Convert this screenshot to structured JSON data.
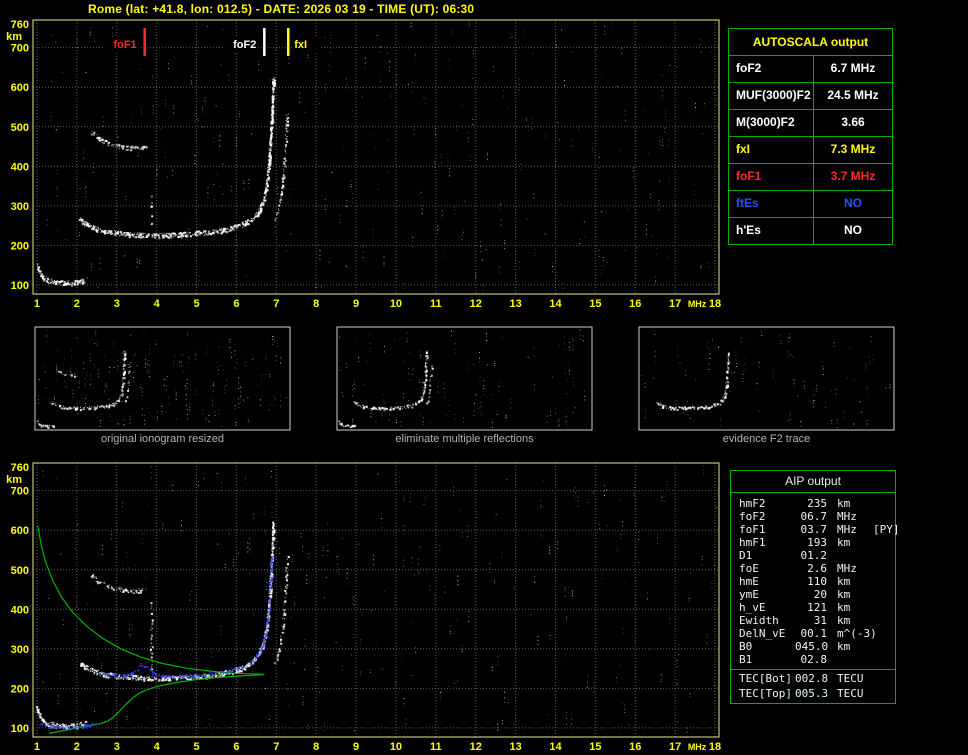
{
  "header": {
    "title": "Rome (lat: +41.8, lon: 012.5) - DATE: 2026 03 19 - TIME (UT): 06:30"
  },
  "colors": {
    "background": "#000000",
    "accent_yellow": "#ffff00",
    "plot_border": "#e6e68e",
    "grid": "#6f6f6f",
    "table_border": "#00b000",
    "trace_white": "#ffffff",
    "trace_blue": "#3040ff",
    "profile_green": "#00b400",
    "caption_gray": "#b4b4b4",
    "thumb_border": "#cfcfcf",
    "red": "#ff2a2a",
    "blue_text": "#2255ff",
    "noise_palette": [
      "#bdbdbd",
      "#8f8f8f",
      "#efefef",
      "#5f5f5f"
    ]
  },
  "autoscala_table": {
    "title": "AUTOSCALA output",
    "rows": [
      {
        "label": "foF2",
        "value": "6.7 MHz",
        "color": "#ffffff"
      },
      {
        "label": "MUF(3000)F2",
        "value": "24.5 MHz",
        "color": "#ffffff"
      },
      {
        "label": "M(3000)F2",
        "value": "3.66",
        "color": "#ffffff"
      },
      {
        "label": "fxI",
        "value": "7.3 MHz",
        "color": "#ffff00"
      },
      {
        "label": "foF1",
        "value": "3.7 MHz",
        "color": "#ff2a2a"
      },
      {
        "label": "ftEs",
        "value": "NO",
        "color": "#2255ff"
      },
      {
        "label": "h'Es",
        "value": "NO",
        "color": "#ffffff"
      }
    ]
  },
  "thumbnails": [
    {
      "caption": "original ionogram resized",
      "trace_indices": [
        0,
        1,
        2,
        3
      ],
      "noise_events": 150
    },
    {
      "caption": "eliminate multiple reflections",
      "trace_indices": [
        0,
        1,
        3
      ],
      "noise_events": 110
    },
    {
      "caption": "evidence F2 trace",
      "trace_indices": [
        1
      ],
      "noise_events": 80
    }
  ],
  "aip_table": {
    "title": "AIP output",
    "rows": [
      {
        "label": "hmF2",
        "value": "235",
        "unit": "km",
        "note": "",
        "sep": false
      },
      {
        "label": "foF2",
        "value": "06.7",
        "unit": "MHz",
        "note": "",
        "sep": false
      },
      {
        "label": "foF1",
        "value": "03.7",
        "unit": "MHz",
        "note": "[PY]",
        "sep": false
      },
      {
        "label": "hmF1",
        "value": "193",
        "unit": "km",
        "note": "",
        "sep": false
      },
      {
        "label": "D1",
        "value": "01.2",
        "unit": "",
        "note": "",
        "sep": false
      },
      {
        "label": "foE",
        "value": "2.6",
        "unit": "MHz",
        "note": "",
        "sep": false
      },
      {
        "label": "hmE",
        "value": "110",
        "unit": "km",
        "note": "",
        "sep": false
      },
      {
        "label": "ymE",
        "value": "20",
        "unit": "km",
        "note": "",
        "sep": false
      },
      {
        "label": "h_vE",
        "value": "121",
        "unit": "km",
        "note": "",
        "sep": false
      },
      {
        "label": "Ewidth",
        "value": "31",
        "unit": "km",
        "note": "",
        "sep": false
      },
      {
        "label": "DelN_vE",
        "value": "00.1",
        "unit": "m^(-3)",
        "note": "",
        "sep": false
      },
      {
        "label": "B0",
        "value": "045.0",
        "unit": "km",
        "note": "",
        "sep": false
      },
      {
        "label": "B1",
        "value": "02.8",
        "unit": "",
        "note": "",
        "sep": false
      },
      {
        "label": "TEC[Bot]",
        "value": "002.8",
        "unit": "TECU",
        "note": "",
        "sep": true
      },
      {
        "label": "TEC[Top]",
        "value": "005.3",
        "unit": "TECU",
        "note": "",
        "sep": false
      }
    ]
  },
  "chart_data": [
    {
      "id": "top_ionogram",
      "type": "scatter",
      "title": "scaled ionogram with critical frequency markers",
      "xlabel": "MHz",
      "ylabel": "km",
      "xlim": [
        0.9,
        18.1
      ],
      "ylim": [
        77,
        770
      ],
      "x_ticks": [
        1,
        2,
        3,
        4,
        5,
        6,
        7,
        8,
        9,
        10,
        11,
        12,
        13,
        14,
        15,
        16,
        17,
        18
      ],
      "y_ticks": [
        100,
        200,
        300,
        400,
        500,
        600,
        700,
        760
      ],
      "grid": true,
      "critical_frequencies": [
        {
          "label": "foF1",
          "mhz": 3.7,
          "color": "#ff2a2a",
          "side": "left"
        },
        {
          "label": "foF2",
          "mhz": 6.7,
          "color": "#ffffff",
          "side": "left"
        },
        {
          "label": "fxI",
          "mhz": 7.3,
          "color": "#ffff00",
          "side": "right"
        }
      ],
      "traces": [
        {
          "name": "E-layer echo",
          "color": "#ffffff",
          "thickness": 5,
          "density": 2.6,
          "points": [
            [
              1.0,
              150
            ],
            [
              1.05,
              133
            ],
            [
              1.15,
              119
            ],
            [
              1.3,
              111
            ],
            [
              1.5,
              107
            ],
            [
              1.75,
              105
            ],
            [
              2.0,
              107
            ],
            [
              2.2,
              112
            ]
          ]
        },
        {
          "name": "F1-F2 echo",
          "color": "#ffffff",
          "thickness": 5,
          "density": 2.6,
          "points": [
            [
              2.05,
              268
            ],
            [
              2.2,
              255
            ],
            [
              2.45,
              243
            ],
            [
              2.7,
              236
            ],
            [
              3.0,
              231
            ],
            [
              3.4,
              228
            ],
            [
              3.9,
              226
            ],
            [
              4.4,
              227
            ],
            [
              4.9,
              230
            ],
            [
              5.4,
              235
            ],
            [
              5.8,
              242
            ],
            [
              6.1,
              251
            ],
            [
              6.35,
              264
            ],
            [
              6.55,
              285
            ],
            [
              6.68,
              315
            ],
            [
              6.76,
              360
            ],
            [
              6.82,
              420
            ],
            [
              6.86,
              490
            ],
            [
              6.9,
              560
            ],
            [
              6.92,
              620
            ]
          ]
        },
        {
          "name": "second-hop echo",
          "color": "#ffffff",
          "thickness": 4,
          "density": 1.5,
          "points": [
            [
              2.35,
              487
            ],
            [
              2.55,
              470
            ],
            [
              2.8,
              458
            ],
            [
              3.1,
              450
            ],
            [
              3.45,
              447
            ],
            [
              3.75,
              450
            ]
          ]
        },
        {
          "name": "X-mode cusp",
          "color": "#ffffff",
          "thickness": 3,
          "density": 0.8,
          "points": [
            [
              6.95,
              262
            ],
            [
              7.05,
              290
            ],
            [
              7.12,
              330
            ],
            [
              7.18,
              390
            ],
            [
              7.23,
              460
            ],
            [
              7.27,
              540
            ]
          ]
        },
        {
          "name": "interference column",
          "color": "#ffffff",
          "thickness": 3,
          "density": 0.35,
          "points": [
            [
              3.85,
              250
            ],
            [
              3.87,
              330
            ]
          ]
        }
      ],
      "noise_events": 300
    },
    {
      "id": "bottom_ionogram",
      "type": "scatter",
      "title": "ionogram with restored trace (blue) and electron density profile (green)",
      "xlabel": "MHz",
      "ylabel": "km",
      "xlim": [
        0.9,
        18.1
      ],
      "ylim": [
        77,
        770
      ],
      "x_ticks": [
        1,
        2,
        3,
        4,
        5,
        6,
        7,
        8,
        9,
        10,
        11,
        12,
        13,
        14,
        15,
        16,
        17,
        18
      ],
      "y_ticks": [
        100,
        200,
        300,
        400,
        500,
        600,
        700,
        760
      ],
      "grid": true,
      "traces": [
        {
          "name": "E-layer echo",
          "color": "#ffffff",
          "thickness": 5,
          "density": 2.4,
          "points": [
            [
              1.0,
              150
            ],
            [
              1.05,
              133
            ],
            [
              1.15,
              119
            ],
            [
              1.3,
              111
            ],
            [
              1.5,
              107
            ],
            [
              1.75,
              105
            ],
            [
              2.0,
              107
            ],
            [
              2.2,
              112
            ]
          ]
        },
        {
          "name": "F1-F2 echo",
          "color": "#ffffff",
          "thickness": 5,
          "density": 2.4,
          "points": [
            [
              2.05,
              268
            ],
            [
              2.2,
              255
            ],
            [
              2.45,
              243
            ],
            [
              2.7,
              236
            ],
            [
              3.0,
              231
            ],
            [
              3.4,
              228
            ],
            [
              3.9,
              226
            ],
            [
              4.4,
              227
            ],
            [
              4.9,
              230
            ],
            [
              5.4,
              235
            ],
            [
              5.8,
              242
            ],
            [
              6.1,
              251
            ],
            [
              6.35,
              264
            ],
            [
              6.55,
              285
            ],
            [
              6.68,
              315
            ],
            [
              6.76,
              360
            ],
            [
              6.82,
              420
            ],
            [
              6.86,
              490
            ],
            [
              6.9,
              560
            ],
            [
              6.92,
              620
            ]
          ]
        },
        {
          "name": "second-hop echo",
          "color": "#ffffff",
          "thickness": 4,
          "density": 1.2,
          "points": [
            [
              2.35,
              487
            ],
            [
              2.55,
              470
            ],
            [
              2.8,
              458
            ],
            [
              3.1,
              450
            ],
            [
              3.45,
              447
            ],
            [
              3.75,
              450
            ]
          ]
        },
        {
          "name": "X-mode cusp",
          "color": "#ffffff",
          "thickness": 3,
          "density": 0.7,
          "points": [
            [
              6.95,
              262
            ],
            [
              7.05,
              290
            ],
            [
              7.12,
              330
            ],
            [
              7.18,
              390
            ],
            [
              7.23,
              460
            ],
            [
              7.27,
              540
            ]
          ]
        },
        {
          "name": "interference column",
          "color": "#ffffff",
          "thickness": 3,
          "density": 0.5,
          "points": [
            [
              3.85,
              250
            ],
            [
              3.87,
              420
            ]
          ]
        }
      ],
      "blue_traces": [
        {
          "name": "restored E trace",
          "color": "#3040ff",
          "thickness": 3,
          "density": 1.3,
          "points": [
            [
              1.05,
              110
            ],
            [
              1.4,
              104
            ],
            [
              1.8,
              103
            ],
            [
              2.2,
              106
            ],
            [
              2.55,
              112
            ]
          ]
        },
        {
          "name": "restored F trace",
          "color": "#3040ff",
          "thickness": 3,
          "density": 1.1,
          "points": [
            [
              2.6,
              240
            ],
            [
              3.0,
              231
            ],
            [
              3.3,
              235
            ],
            [
              3.5,
              250
            ],
            [
              3.6,
              262
            ],
            [
              3.75,
              252
            ],
            [
              3.9,
              240
            ],
            [
              4.2,
              232
            ],
            [
              4.7,
              231
            ],
            [
              5.2,
              236
            ],
            [
              5.7,
              243
            ],
            [
              6.1,
              253
            ],
            [
              6.4,
              268
            ],
            [
              6.6,
              295
            ],
            [
              6.72,
              335
            ],
            [
              6.8,
              395
            ],
            [
              6.85,
              465
            ],
            [
              6.88,
              535
            ]
          ]
        }
      ],
      "profile": {
        "name": "electron density profile",
        "color": "#00b400",
        "hmF2_km": 235,
        "branches": [
          [
            [
              1.02,
              612
            ],
            [
              1.1,
              565
            ],
            [
              1.22,
              518
            ],
            [
              1.4,
              472
            ],
            [
              1.62,
              430
            ],
            [
              1.9,
              392
            ],
            [
              2.25,
              357
            ],
            [
              2.65,
              326
            ],
            [
              3.1,
              300
            ],
            [
              3.6,
              279
            ],
            [
              4.15,
              263
            ],
            [
              4.75,
              251
            ],
            [
              5.4,
              243
            ],
            [
              6.0,
              238
            ],
            [
              6.5,
              236
            ],
            [
              6.7,
              235
            ]
          ],
          [
            [
              1.3,
              86
            ],
            [
              1.55,
              91
            ],
            [
              1.85,
              97
            ],
            [
              2.15,
              103
            ],
            [
              2.45,
              108
            ],
            [
              2.6,
              111
            ],
            [
              2.75,
              116
            ],
            [
              2.9,
              126
            ],
            [
              3.05,
              140
            ],
            [
              3.2,
              157
            ],
            [
              3.4,
              176
            ],
            [
              3.6,
              190
            ],
            [
              3.7,
              194
            ],
            [
              3.85,
              200
            ],
            [
              4.1,
              207
            ],
            [
              4.5,
              215
            ],
            [
              5.0,
              222
            ],
            [
              5.5,
              227
            ],
            [
              6.0,
              231
            ],
            [
              6.4,
              233
            ],
            [
              6.7,
              235
            ]
          ]
        ]
      },
      "noise_events": 280
    }
  ]
}
